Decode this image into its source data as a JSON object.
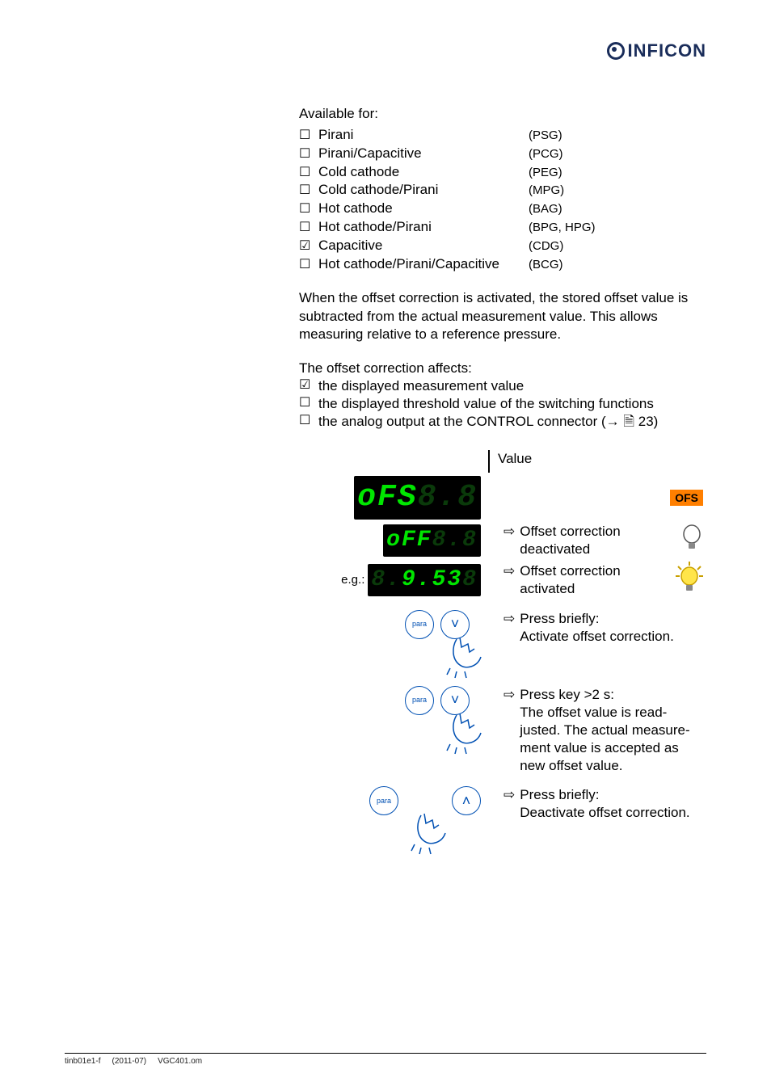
{
  "brand": "INFICON",
  "available": {
    "title": "Available for:",
    "items": [
      {
        "mark": "☐",
        "name": "Pirani",
        "code": "(PSG)"
      },
      {
        "mark": "☐",
        "name": "Pirani/Capacitive",
        "code": "(PCG)"
      },
      {
        "mark": "☐",
        "name": "Cold cathode",
        "code": "(PEG)"
      },
      {
        "mark": "☐",
        "name": "Cold cathode/Pirani",
        "code": "(MPG)"
      },
      {
        "mark": "☐",
        "name": "Hot cathode",
        "code": "(BAG)"
      },
      {
        "mark": "☐",
        "name": "Hot cathode/Pirani",
        "code": "(BPG, HPG)"
      },
      {
        "mark": "☑",
        "name": "Capacitive",
        "code": "(CDG)"
      },
      {
        "mark": "☐",
        "name": "Hot cathode/Pirani/Capacitive",
        "code": "(BCG)"
      }
    ]
  },
  "description": "When the offset correction is activated, the stored offset value is subtracted from the actual measurement value. This allows measuring relative to a reference pressure.",
  "affects": {
    "title": "The offset correction affects:",
    "items": [
      {
        "mark": "☑",
        "text": "the displayed measurement value"
      },
      {
        "mark": "☐",
        "text": "the displayed threshold value of the switching functions"
      },
      {
        "mark": "☐",
        "text": "the analog output at the CONTROL connector (→ 🗎 23)"
      }
    ]
  },
  "buttons": {
    "para": "para"
  },
  "table": {
    "header": "Value",
    "ofs_badge": "OFS",
    "eg": "e.g.:",
    "displays": [
      {
        "lit": "oFS",
        "dim": "8.8"
      },
      {
        "lit": "oFF",
        "dim": "8.8"
      },
      {
        "dimpre": "8.",
        "lit": "9.53",
        "dim": "8"
      }
    ],
    "rows": [
      {
        "text": "Offset correction deactivated"
      },
      {
        "text": "Offset correction activated"
      }
    ],
    "actions": [
      {
        "text": "Press briefly:\nActivate offset correction."
      },
      {
        "text": "Press key >2 s:\nThe offset value is read-justed. The actual measure-ment value is accepted as new offset value."
      },
      {
        "text": "Press briefly:\nDeactivate offset correction."
      }
    ]
  },
  "footer": {
    "doc": "tinb01e1-f",
    "date": "(2011-07)",
    "file": "VGC401.om"
  }
}
